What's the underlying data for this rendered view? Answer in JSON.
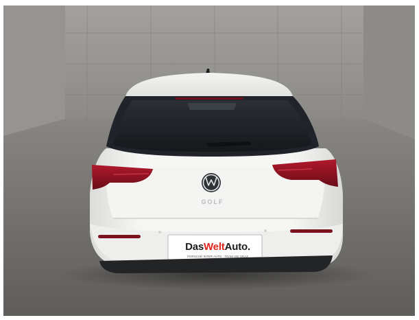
{
  "photo": {
    "subject": "car-rear-view",
    "model_badge": "GOLF",
    "plate": {
      "brand_part1": "Das ",
      "brand_accent": "Welt",
      "brand_part2": "Auto.",
      "small_print": "PORSCHE INTER AUTO · TEAM VW GRAZ"
    },
    "colors": {
      "car_body": "#f2f2f0",
      "glass": "#1a1d22",
      "taillight": "#8c1020",
      "wall": "#8e8c88",
      "floor": "#6e6c69",
      "plate_accent": "#e1251b"
    },
    "icons": [
      "vw-logo-icon"
    ]
  }
}
